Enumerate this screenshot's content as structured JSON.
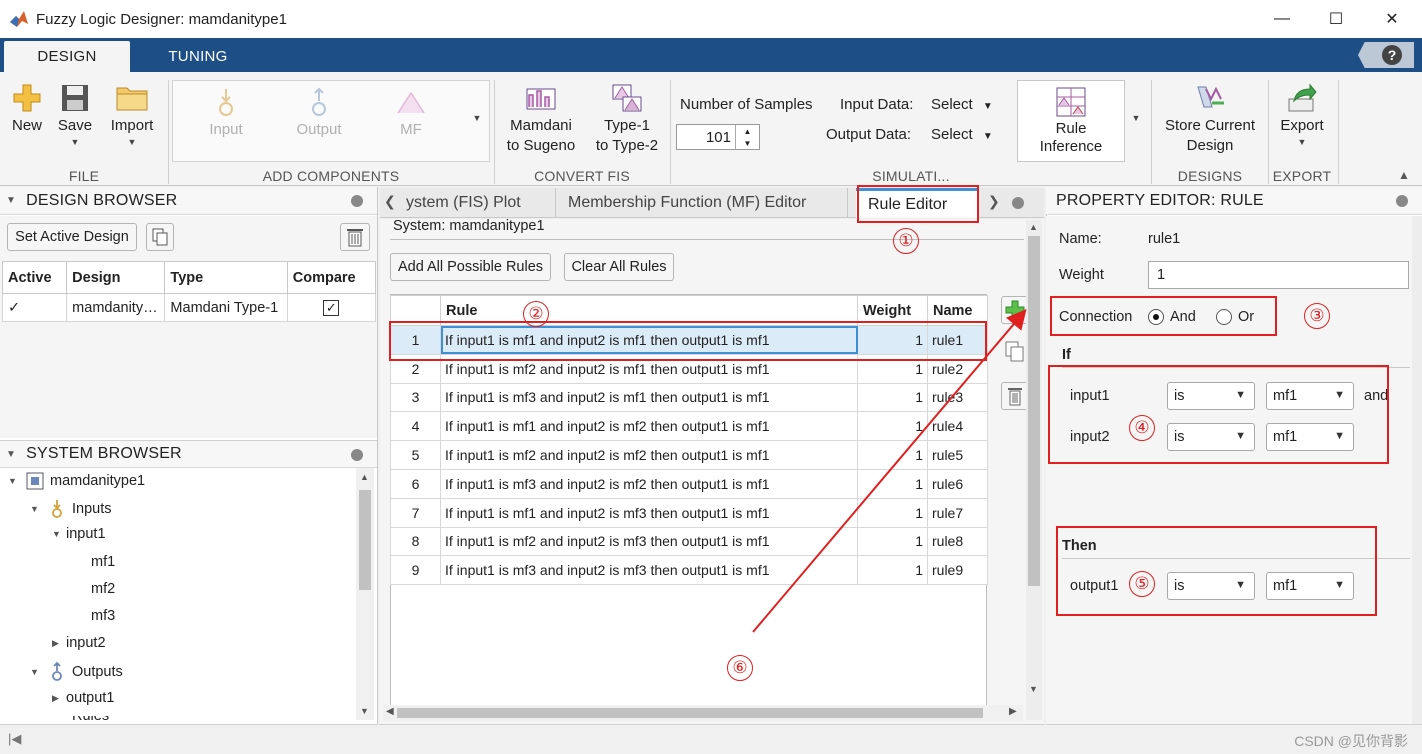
{
  "window": {
    "title": "Fuzzy Logic Designer: mamdanitype1",
    "minimize": "—",
    "maximize": "☐",
    "close": "✕"
  },
  "tabs": {
    "design": "DESIGN",
    "tuning": "TUNING",
    "help": "?"
  },
  "ribbon": {
    "file": {
      "label": "FILE",
      "new": "New",
      "save": "Save",
      "import": "Import"
    },
    "add_components": {
      "label": "ADD COMPONENTS",
      "input": "Input",
      "output": "Output",
      "mf": "MF"
    },
    "convert_fis": {
      "label": "CONVERT FIS",
      "mamdani_line1": "Mamdani",
      "mamdani_line2": "to Sugeno",
      "type1_line1": "Type-1",
      "type1_line2": "to Type-2"
    },
    "simulation": {
      "label": "SIMULATI...",
      "num_samples_label": "Number of Samples",
      "num_samples_value": "101",
      "input_data_label": "Input Data:",
      "input_data_value": "Select",
      "output_data_label": "Output Data:",
      "output_data_value": "Select",
      "rule_inference_line1": "Rule",
      "rule_inference_line2": "Inference"
    },
    "designs": {
      "label": "DESIGNS",
      "store_line1": "Store Current",
      "store_line2": "Design"
    },
    "export": {
      "label": "EXPORT",
      "export": "Export"
    }
  },
  "design_browser": {
    "title": "DESIGN BROWSER",
    "set_active": "Set Active Design",
    "columns": [
      "Active",
      "Design",
      "Type",
      "Compare"
    ],
    "rows": [
      {
        "active": "✓",
        "design": "mamdanity…",
        "type": "Mamdani Type-1",
        "compare": true
      }
    ]
  },
  "system_browser": {
    "title": "SYSTEM BROWSER",
    "root": "mamdanitype1",
    "inputs": "Inputs",
    "input1": "input1",
    "mf1": "mf1",
    "mf2": "mf2",
    "mf3": "mf3",
    "input2": "input2",
    "outputs": "Outputs",
    "output1": "output1",
    "rules": "Rules"
  },
  "doc_tabs": {
    "fis_plot": "ystem (FIS) Plot",
    "mf_editor": "Membership Function (MF) Editor",
    "rule_editor": "Rule Editor"
  },
  "rule_editor": {
    "system_label": "System: mamdanitype1",
    "add_all": "Add All Possible Rules",
    "clear_all": "Clear All Rules",
    "columns": [
      "",
      "Rule",
      "Weight",
      "Name"
    ],
    "rows": [
      {
        "n": "1",
        "rule": "If input1 is mf1 and input2 is mf1 then output1 is mf1",
        "weight": "1",
        "name": "rule1"
      },
      {
        "n": "2",
        "rule": "If input1 is mf2 and input2 is mf1 then output1 is mf1",
        "weight": "1",
        "name": "rule2"
      },
      {
        "n": "3",
        "rule": "If input1 is mf3 and input2 is mf1 then output1 is mf1",
        "weight": "1",
        "name": "rule3"
      },
      {
        "n": "4",
        "rule": "If input1 is mf1 and input2 is mf2 then output1 is mf1",
        "weight": "1",
        "name": "rule4"
      },
      {
        "n": "5",
        "rule": "If input1 is mf2 and input2 is mf2 then output1 is mf1",
        "weight": "1",
        "name": "rule5"
      },
      {
        "n": "6",
        "rule": "If input1 is mf3 and input2 is mf2 then output1 is mf1",
        "weight": "1",
        "name": "rule6"
      },
      {
        "n": "7",
        "rule": "If input1 is mf1 and input2 is mf3 then output1 is mf1",
        "weight": "1",
        "name": "rule7"
      },
      {
        "n": "8",
        "rule": "If input1 is mf2 and input2 is mf3 then output1 is mf1",
        "weight": "1",
        "name": "rule8"
      },
      {
        "n": "9",
        "rule": "If input1 is mf3 and input2 is mf3 then output1 is mf1",
        "weight": "1",
        "name": "rule9"
      }
    ],
    "selected_row": 1
  },
  "property_editor": {
    "title": "PROPERTY EDITOR: RULE",
    "name_label": "Name:",
    "name_value": "rule1",
    "weight_label": "Weight",
    "weight_value": "1",
    "connection_label": "Connection",
    "and_label": "And",
    "or_label": "Or",
    "connection_selected": "And",
    "if_label": "If",
    "input1_label": "input1",
    "input1_is": "is",
    "input1_mf": "mf1",
    "and_trail": "and",
    "input2_label": "input2",
    "input2_is": "is",
    "input2_mf": "mf1",
    "then_label": "Then",
    "output1_label": "output1",
    "output1_is": "is",
    "output1_mf": "mf1"
  },
  "annotations": {
    "n1": "①",
    "n2": "②",
    "n3": "③",
    "n4": "④",
    "n5": "⑤",
    "n6": "⑥",
    "color": "#e02020"
  },
  "watermark": "CSDN @见你背影",
  "colors": {
    "tabstrip": "#1d4f86",
    "selection": "#dcebf8",
    "selection_border": "#3f8fd6"
  }
}
